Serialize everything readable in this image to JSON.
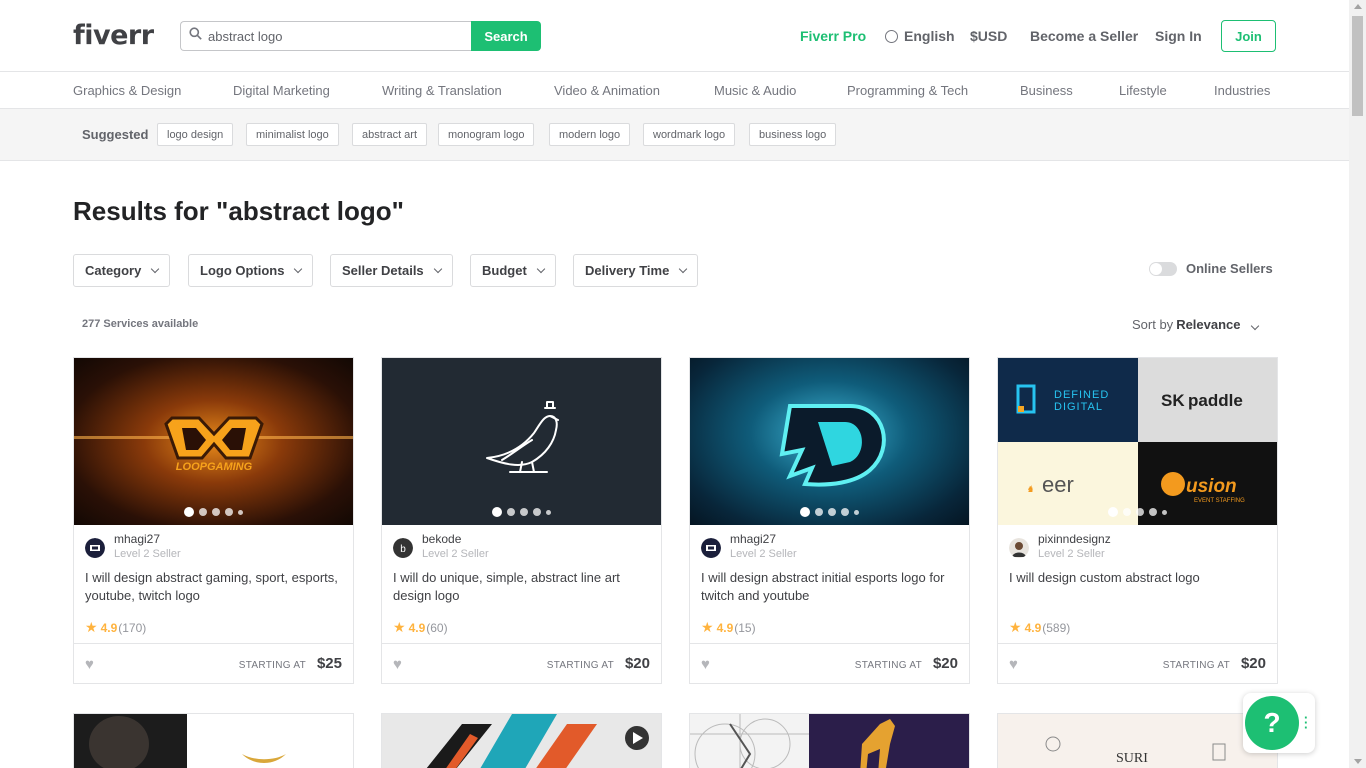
{
  "header": {
    "logo": "fiverr",
    "search_value": "abstract logo",
    "search_label": "Search",
    "nav": {
      "pro": "Fiverr Pro",
      "language": "English",
      "currency": "$USD",
      "become_seller": "Become a Seller",
      "sign_in": "Sign In",
      "join": "Join"
    }
  },
  "categories": [
    "Graphics & Design",
    "Digital Marketing",
    "Writing & Translation",
    "Video & Animation",
    "Music & Audio",
    "Programming & Tech",
    "Business",
    "Lifestyle",
    "Industries"
  ],
  "suggested": {
    "label": "Suggested",
    "chips": [
      "logo design",
      "minimalist logo",
      "abstract art",
      "monogram logo",
      "modern logo",
      "wordmark logo",
      "business logo"
    ]
  },
  "results": {
    "title": "Results for \"abstract logo\"",
    "filters": [
      "Category",
      "Logo Options",
      "Seller Details",
      "Budget",
      "Delivery Time"
    ],
    "online_sellers": "Online Sellers",
    "count": "277 Services available",
    "sort_label": "Sort by",
    "sort_value": "Relevance"
  },
  "gigs": [
    {
      "seller": "mhagi27",
      "level": "Level 2 Seller",
      "title": "I will design abstract gaming, sport, esports, youtube, twitch logo",
      "rating": "4.9",
      "reviews": "(170)",
      "starting": "STARTING AT",
      "price": "$25",
      "image_text": "LOOPGAMING"
    },
    {
      "seller": "bekode",
      "level": "Level 2 Seller",
      "title": "I will do unique, simple, abstract line art design logo",
      "rating": "4.9",
      "reviews": "(60)",
      "starting": "STARTING AT",
      "price": "$20"
    },
    {
      "seller": "mhagi27",
      "level": "Level 2 Seller",
      "title": "I will design abstract initial esports logo for twitch and youtube",
      "rating": "4.9",
      "reviews": "(15)",
      "starting": "STARTING AT",
      "price": "$20"
    },
    {
      "seller": "pixinndesignz",
      "level": "Level 2 Seller",
      "title": "I will design custom abstract logo",
      "rating": "4.9",
      "reviews": "(589)",
      "starting": "STARTING AT",
      "price": "$20",
      "image_texts": [
        "DEFINED",
        "DIGITAL",
        "SK",
        "paddle",
        "eer",
        "usion",
        "EVENT STAFFING"
      ]
    }
  ],
  "help": "?",
  "colors": {
    "brand": "#1dbf73",
    "star": "#ffb33e",
    "text": "#404145"
  }
}
